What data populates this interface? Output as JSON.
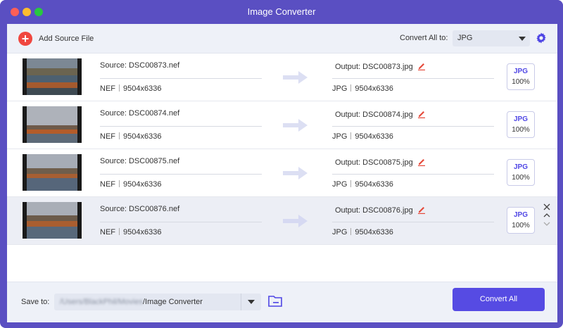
{
  "window": {
    "title": "Image Converter"
  },
  "toolbar": {
    "add_source_label": "Add Source File",
    "convert_all_to_label": "Convert All to:",
    "format_value": "JPG"
  },
  "files": [
    {
      "source": "Source: DSC00873.nef",
      "src_format": "NEF",
      "src_dims": "9504x6336",
      "output": "Output: DSC00873.jpg",
      "out_format": "JPG",
      "out_dims": "9504x6336",
      "badge_format": "JPG",
      "badge_quality": "100%"
    },
    {
      "source": "Source: DSC00874.nef",
      "src_format": "NEF",
      "src_dims": "9504x6336",
      "output": "Output: DSC00874.jpg",
      "out_format": "JPG",
      "out_dims": "9504x6336",
      "badge_format": "JPG",
      "badge_quality": "100%"
    },
    {
      "source": "Source: DSC00875.nef",
      "src_format": "NEF",
      "src_dims": "9504x6336",
      "output": "Output: DSC00875.jpg",
      "out_format": "JPG",
      "out_dims": "9504x6336",
      "badge_format": "JPG",
      "badge_quality": "100%"
    },
    {
      "source": "Source: DSC00876.nef",
      "src_format": "NEF",
      "src_dims": "9504x6336",
      "output": "Output: DSC00876.jpg",
      "out_format": "JPG",
      "out_dims": "9504x6336",
      "badge_format": "JPG",
      "badge_quality": "100%"
    }
  ],
  "footer": {
    "save_to_label": "Save to:",
    "path_hidden": "/Users/BlackPhil/Movies",
    "path_visible": "/Image Converter",
    "convert_all_label": "Convert All"
  },
  "colors": {
    "titlebar": "#5a4fc2",
    "accent": "#564be3",
    "add_icon": "#f0473f",
    "edit_icon": "#e5493a"
  },
  "icons": {
    "add": "plus-circle-icon",
    "settings": "gear-icon",
    "edit": "pencil-icon",
    "arrow": "arrow-right-icon",
    "remove": "close-icon",
    "move_up": "chevron-up-icon",
    "move_down": "chevron-down-icon",
    "folder": "folder-icon"
  }
}
